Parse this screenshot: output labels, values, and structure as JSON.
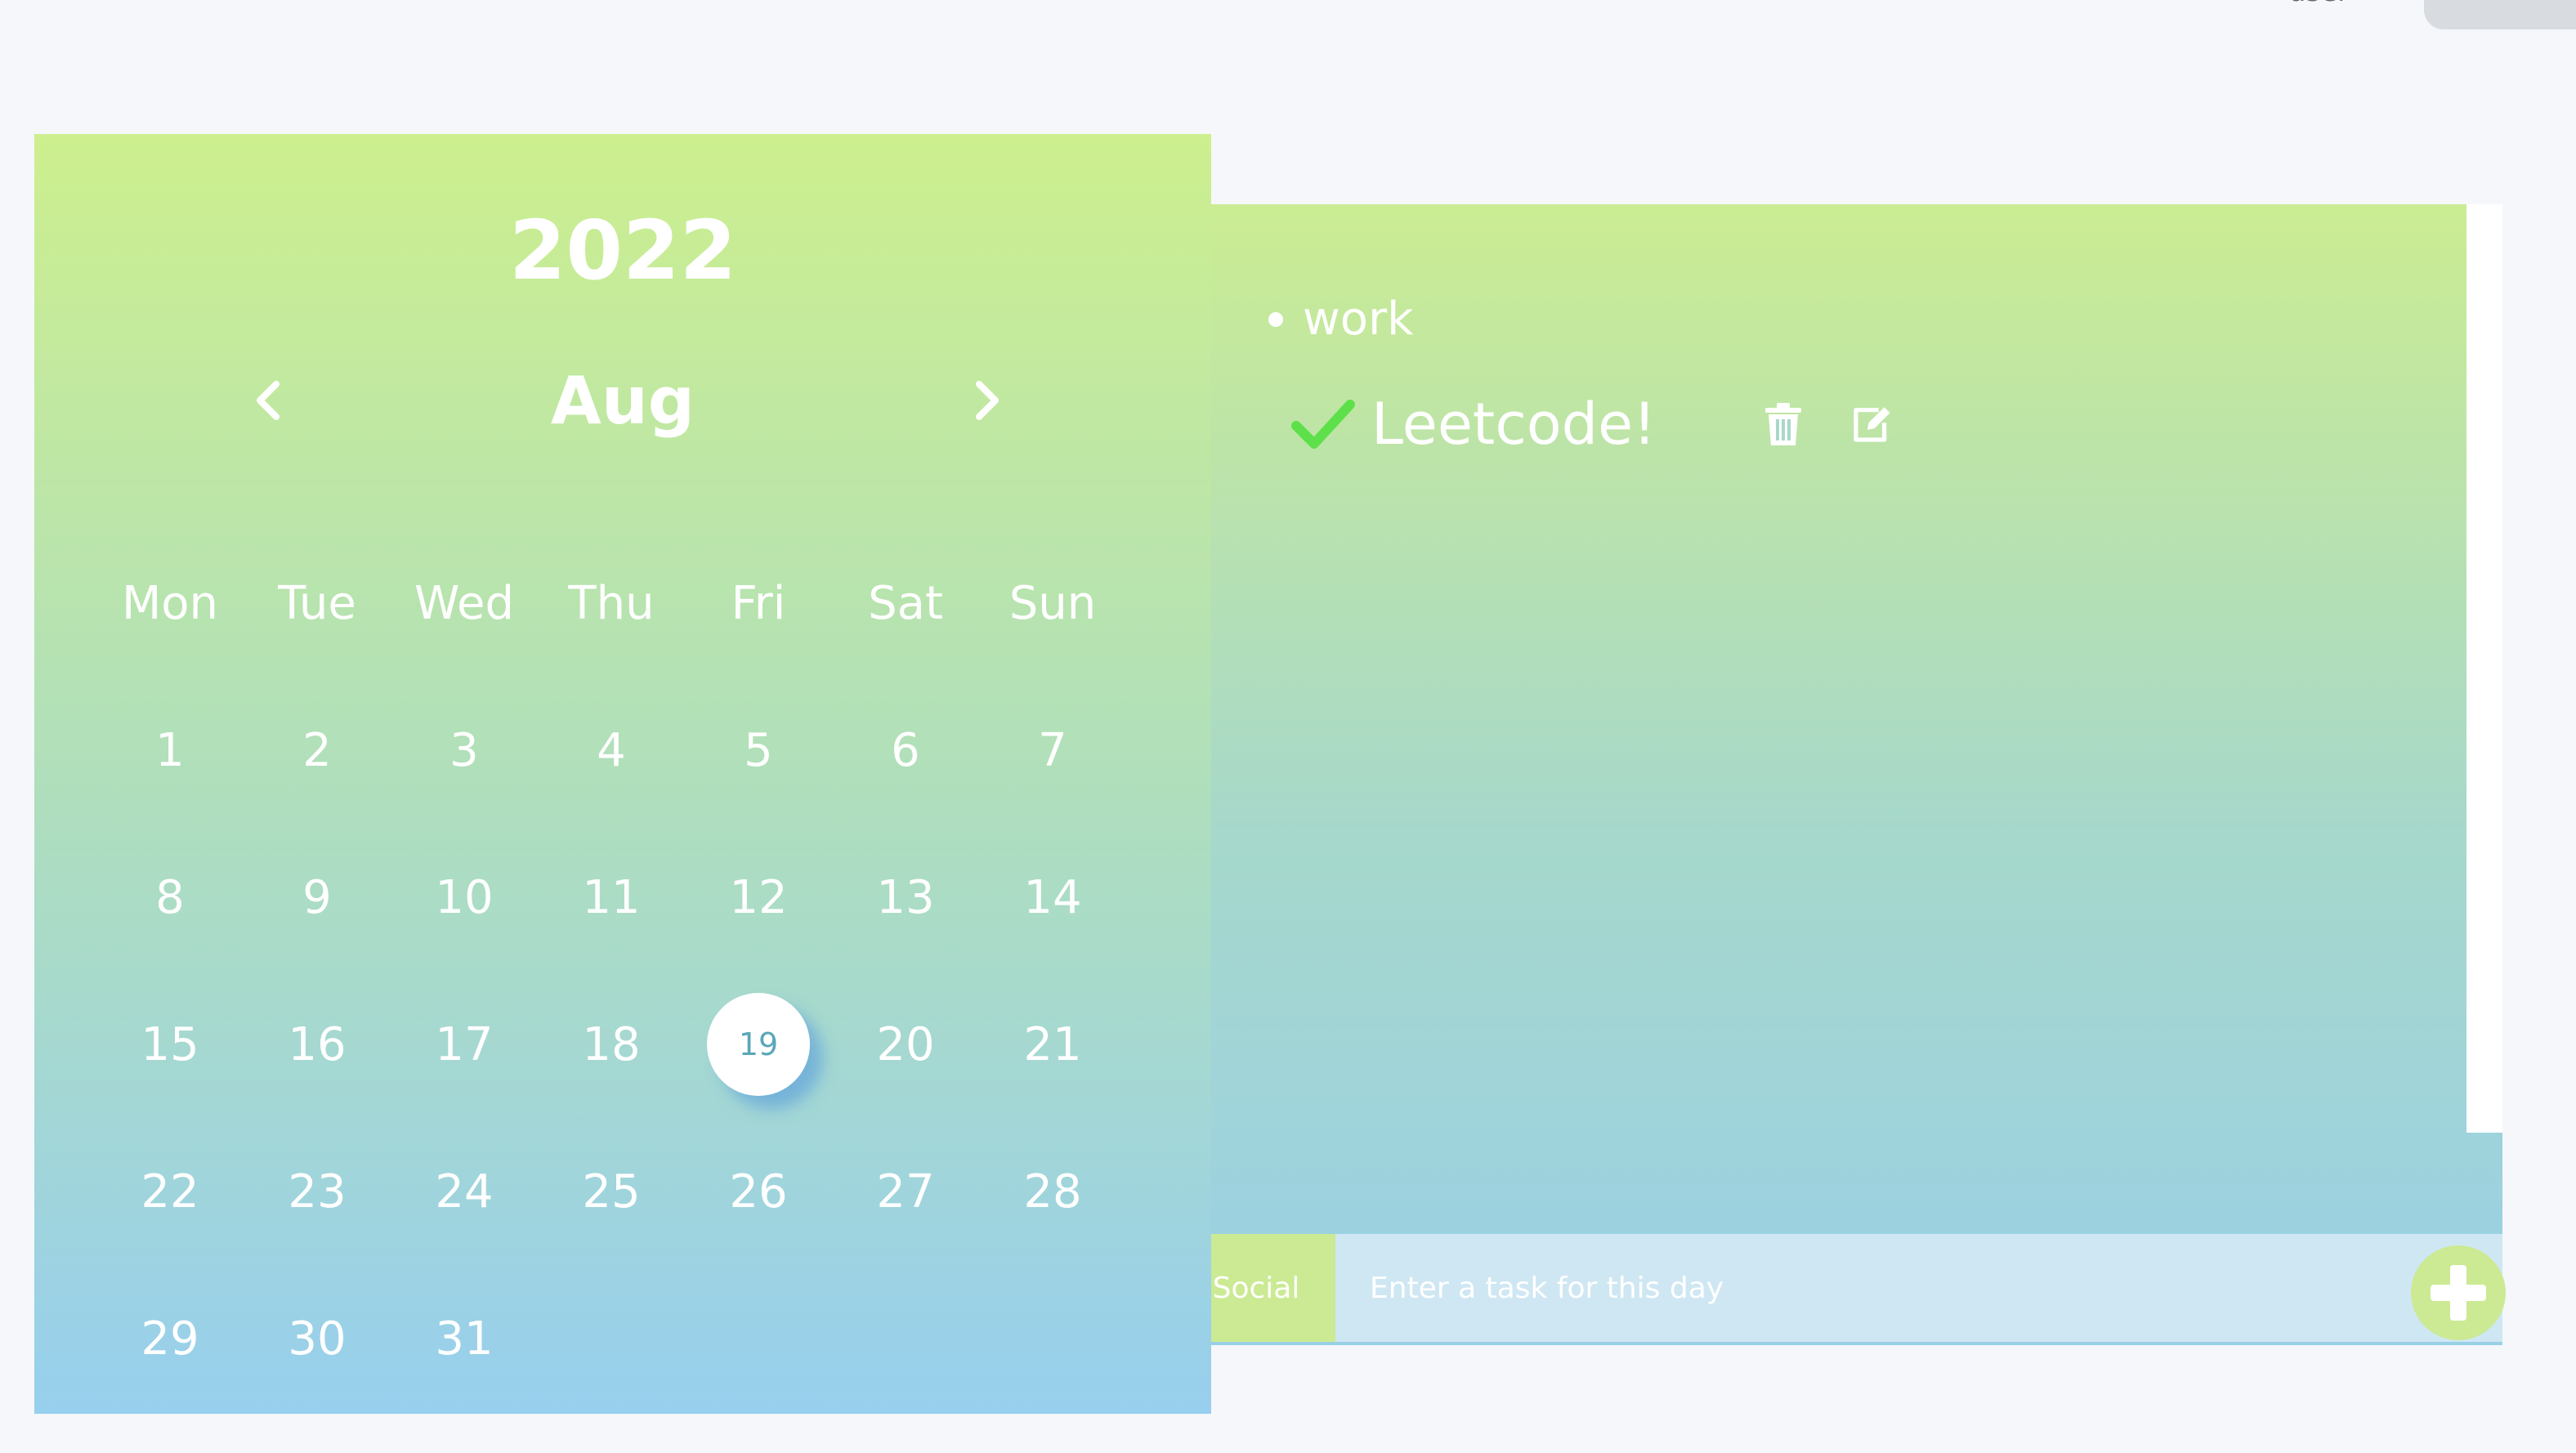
{
  "topbar": {
    "user_label": "user"
  },
  "calendar": {
    "year": "2022",
    "month": "Aug",
    "weekdays": [
      "Mon",
      "Tue",
      "Wed",
      "Thu",
      "Fri",
      "Sat",
      "Sun"
    ],
    "days": [
      "1",
      "2",
      "3",
      "4",
      "5",
      "6",
      "7",
      "8",
      "9",
      "10",
      "11",
      "12",
      "13",
      "14",
      "15",
      "16",
      "17",
      "18",
      "19",
      "20",
      "21",
      "22",
      "23",
      "24",
      "25",
      "26",
      "27",
      "28",
      "29",
      "30",
      "31"
    ],
    "selected_day": "19"
  },
  "tasks": {
    "category": "work",
    "items": [
      {
        "label": "Leetcode!",
        "done": true
      }
    ]
  },
  "input": {
    "category_chip": "Social",
    "placeholder": "Enter a task for this day"
  },
  "colors": {
    "accent_green": "#cbea93",
    "check_green": "#5ee04a",
    "selected_day_text": "#5aa7b8"
  },
  "icons": {
    "prev": "chevron-left-icon",
    "next": "chevron-right-icon",
    "done": "check-icon",
    "delete": "trash-icon",
    "edit": "edit-icon",
    "add": "plus-icon"
  }
}
